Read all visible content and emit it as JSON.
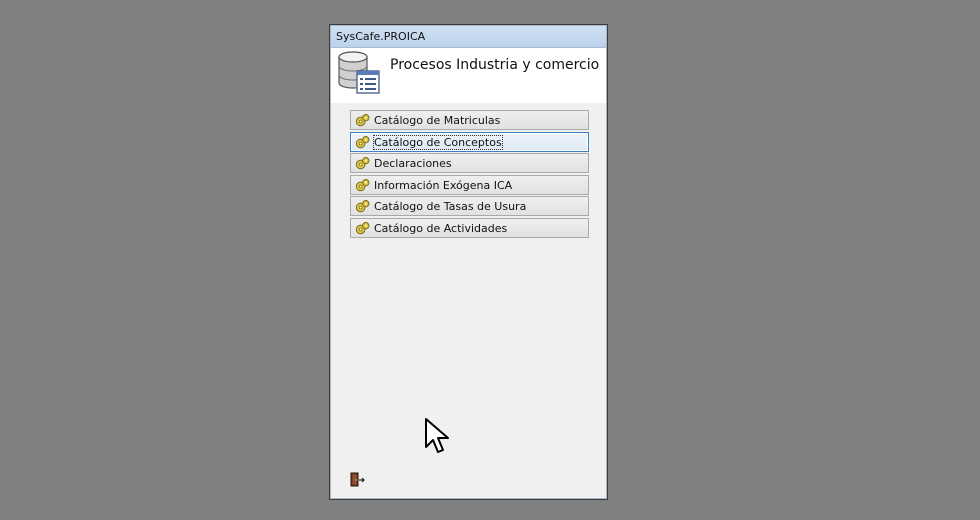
{
  "window": {
    "title": "SysCafe.PROICA",
    "header_title": "Procesos Industria y comercio"
  },
  "menu": {
    "items": [
      {
        "label": "Catálogo de Matriculas",
        "icon": "gear-icon",
        "focused": false
      },
      {
        "label": "Catálogo de Conceptos",
        "icon": "gear-icon",
        "focused": true
      },
      {
        "label": "Declaraciones",
        "icon": "gear-icon",
        "focused": false
      },
      {
        "label": "Información Exógena ICA",
        "icon": "gear-icon",
        "focused": false
      },
      {
        "label": "Catálogo de Tasas de Usura",
        "icon": "gear-icon",
        "focused": false
      },
      {
        "label": "Catálogo de Actividades",
        "icon": "gear-icon",
        "focused": false
      }
    ]
  },
  "footer": {
    "exit_icon": "exit-door-icon"
  },
  "colors": {
    "desktop": "#808080",
    "titlebar": "#c6d9ef",
    "focus_border": "#3c7fc7"
  }
}
